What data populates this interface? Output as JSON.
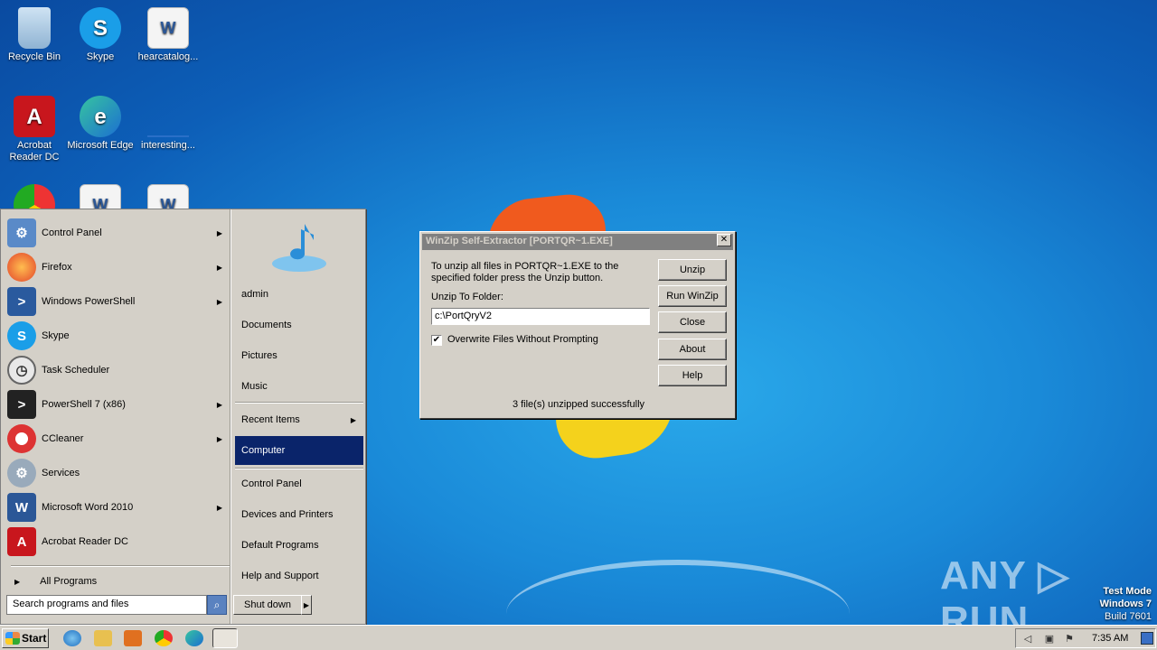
{
  "desktop": {
    "icons": [
      {
        "label": "Recycle Bin",
        "icon": "recycle-bin-icon"
      },
      {
        "label": "Skype",
        "icon": "skype-icon"
      },
      {
        "label": "hearcatalog...",
        "icon": "word-doc-icon"
      },
      {
        "label": "Acrobat\nReader DC",
        "icon": "acrobat-icon"
      },
      {
        "label": "Microsoft Edge",
        "icon": "edge-icon"
      },
      {
        "label": "interesting...",
        "icon": "file-icon"
      }
    ]
  },
  "start_menu": {
    "programs": [
      {
        "label": "Control Panel",
        "icon": "control-panel-icon",
        "has_submenu": true
      },
      {
        "label": "Firefox",
        "icon": "firefox-icon",
        "has_submenu": true
      },
      {
        "label": "Windows PowerShell",
        "icon": "powershell-icon",
        "has_submenu": true
      },
      {
        "label": "Skype",
        "icon": "skype-icon",
        "has_submenu": false
      },
      {
        "label": "Task Scheduler",
        "icon": "task-scheduler-icon",
        "has_submenu": false
      },
      {
        "label": "PowerShell 7 (x86)",
        "icon": "powershell7-icon",
        "has_submenu": true
      },
      {
        "label": "CCleaner",
        "icon": "ccleaner-icon",
        "has_submenu": true
      },
      {
        "label": "Services",
        "icon": "services-icon",
        "has_submenu": false
      },
      {
        "label": "Microsoft Word 2010",
        "icon": "word-icon",
        "has_submenu": true
      },
      {
        "label": "Acrobat Reader DC",
        "icon": "acrobat-icon",
        "has_submenu": false
      }
    ],
    "all_programs": "All Programs",
    "search_placeholder": "Search programs and files",
    "right_items": {
      "user": "admin",
      "documents": "Documents",
      "pictures": "Pictures",
      "music": "Music",
      "recent_items": "Recent Items",
      "computer": "Computer",
      "control_panel": "Control Panel",
      "devices_printers": "Devices and Printers",
      "default_programs": "Default Programs",
      "help_support": "Help and Support"
    },
    "shutdown_label": "Shut down"
  },
  "dialog": {
    "title": "WinZip Self-Extractor [PORTQR~1.EXE]",
    "message": "To unzip all files in PORTQR~1.EXE to the specified folder press the Unzip button.",
    "folder_label": "Unzip To Folder:",
    "folder_value": "c:\\PortQryV2",
    "overwrite_label": "Overwrite Files Without Prompting",
    "overwrite_checked": true,
    "buttons": {
      "unzip": "Unzip",
      "run_winzip": "Run WinZip",
      "close": "Close",
      "about": "About",
      "help": "Help"
    },
    "status": "3 file(s) unzipped successfully"
  },
  "taskbar": {
    "start_label": "Start",
    "clock": "7:35 AM"
  },
  "watermark": {
    "text": "ANY ▷ RUN",
    "test_mode": "Test Mode",
    "os": "Windows 7",
    "build": "Build 7601"
  }
}
